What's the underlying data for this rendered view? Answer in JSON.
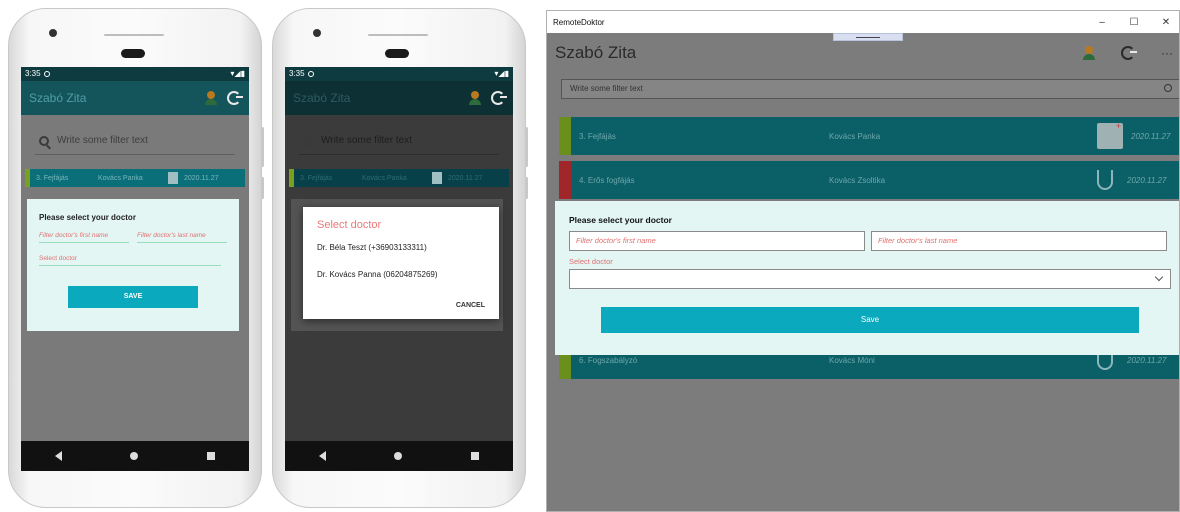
{
  "phone1": {
    "status_time": "3:35",
    "status_right": "▾◢▮",
    "app_title": "Szabó Zita",
    "search_placeholder": "Write some filter text",
    "row": {
      "title": "3. Fejfájás",
      "doctor": "Kovács Panka",
      "date": "2020.11.27"
    },
    "dialog": {
      "heading": "Please select your doctor",
      "first_name_placeholder": "Filter doctor's first name",
      "last_name_placeholder": "Filter doctor's last name",
      "select_placeholder": "Select doctor",
      "save_label": "SAVE"
    }
  },
  "phone2": {
    "status_time": "3:35",
    "status_right": "▾◢▮",
    "app_title": "Szabó Zita",
    "search_placeholder": "Write some filter text",
    "row": {
      "title": "3. Fejfájás",
      "doctor": "Kovács Panka",
      "date": "2020.11.27"
    },
    "dialog": {
      "heading": "Select doctor",
      "options": [
        "Dr. Béla Teszt (+36903133311)",
        "Dr. Kovács Panna (06204875269)"
      ],
      "cancel_label": "CANCEL"
    }
  },
  "desktop": {
    "window_title": "RemoteDoktor",
    "controls": {
      "minimize": "–",
      "maximize": "☐",
      "close": "✕"
    },
    "user_name": "Szabó Zita",
    "more_label": "···",
    "search_placeholder": "Write some filter text",
    "rows": [
      {
        "title": "3. Fejfájás",
        "doctor": "Kovács Panka",
        "date": "2020.11.27",
        "flag": "green"
      },
      {
        "title": "4. Erős fogfájás",
        "doctor": "Kovács Zsoltika",
        "date": "2020.11.27",
        "flag": "red"
      },
      {
        "title": "6. Fogszabályzó",
        "doctor": "Kovács Móni",
        "date": "2020.11.27",
        "flag": "green"
      }
    ],
    "dialog": {
      "heading": "Please select your doctor",
      "first_name_placeholder": "Filter doctor's first name",
      "last_name_placeholder": "Filter doctor's last name",
      "select_label": "Select doctor",
      "save_label": "Save"
    }
  }
}
